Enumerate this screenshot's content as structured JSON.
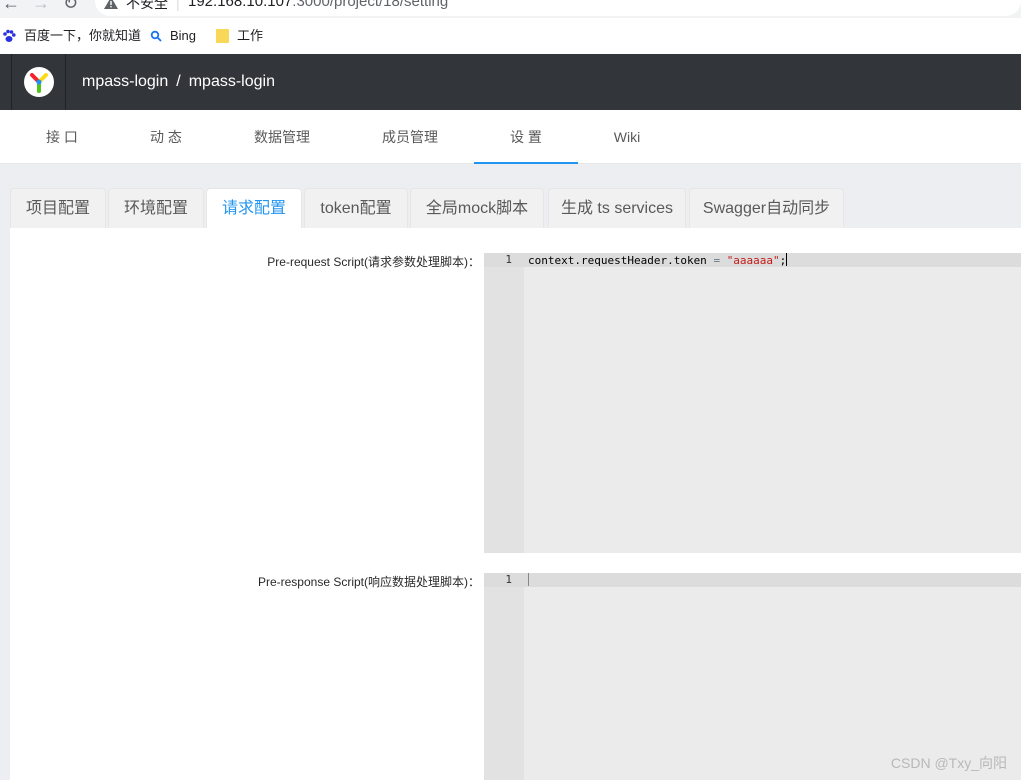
{
  "browser": {
    "back_icon": "arrow-left-icon",
    "forward_icon": "arrow-right-icon",
    "reload_icon": "reload-icon",
    "insecure_label": "不安全",
    "url_host": "192.168.10.107",
    "url_path": ":3000/project/18/setting"
  },
  "bookmarks": [
    {
      "label": "百度一下，你就知道",
      "icon": "baidu-paw-icon"
    },
    {
      "label": "Bing",
      "icon": "bing-search-icon"
    },
    {
      "label": "工作",
      "icon": "folder-icon"
    }
  ],
  "header": {
    "project_group": "mpass-login",
    "separator": "/",
    "project_name": "mpass-login"
  },
  "project_nav": [
    {
      "label": "接 口",
      "active": false
    },
    {
      "label": "动 态",
      "active": false
    },
    {
      "label": "数据管理",
      "active": false
    },
    {
      "label": "成员管理",
      "active": false
    },
    {
      "label": "设 置",
      "active": true
    },
    {
      "label": "Wiki",
      "active": false
    }
  ],
  "settings_tabs": [
    {
      "label": "项目配置",
      "active": false
    },
    {
      "label": "环境配置",
      "active": false
    },
    {
      "label": "请求配置",
      "active": true
    },
    {
      "label": "token配置",
      "active": false
    },
    {
      "label": "全局mock脚本",
      "active": false
    },
    {
      "label": "生成 ts services",
      "active": false
    },
    {
      "label": "Swagger自动同步",
      "active": false
    }
  ],
  "request_script": {
    "label": "Pre-request Script(请求参数处理脚本)：",
    "line_number": "1",
    "code_prefix": "context.requestHeader.token ",
    "code_operator": "=",
    "code_string": "\"aaaaaa\"",
    "code_suffix": ";"
  },
  "response_script": {
    "label": "Pre-response Script(响应数据处理脚本)：",
    "line_number": "1",
    "code": ""
  },
  "watermark": "CSDN @Txy_向阳",
  "colors": {
    "accent": "#2395f1",
    "header_bg": "#32363a",
    "editor_bg": "#ebebeb"
  }
}
